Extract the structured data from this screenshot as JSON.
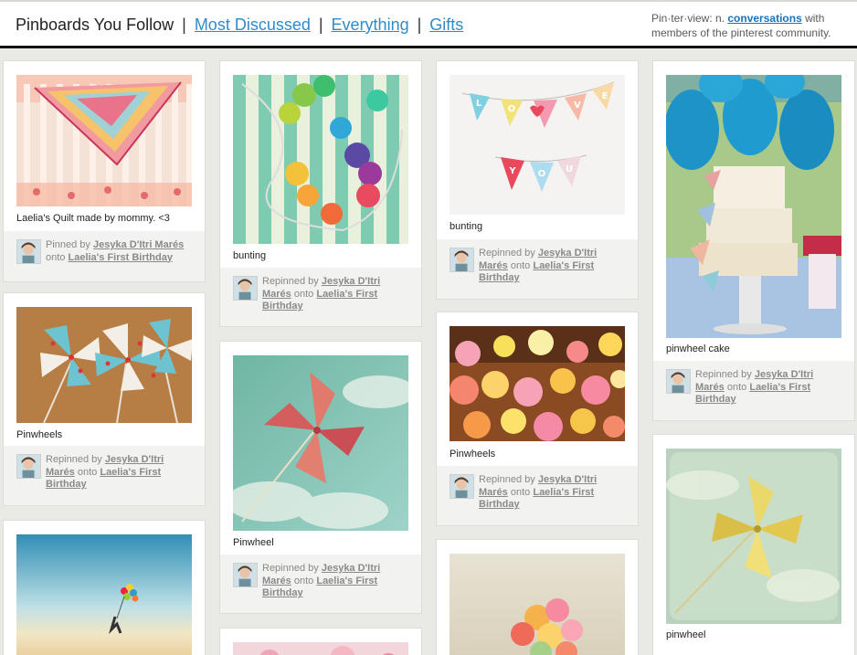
{
  "header": {
    "nav": {
      "current": "Pinboards You Follow",
      "links": [
        "Most Discussed",
        "Everything",
        "Gifts"
      ],
      "separator": "|"
    },
    "tagline": {
      "prefix": "Pin·ter·view: n.",
      "link": "conversations",
      "suffix": "with members of the pinterest community."
    }
  },
  "pins": [
    {
      "description": "Laelia's Quilt made by mommy. <3",
      "action": "Pinned by",
      "user": "Jesyka D'Itri Marés",
      "onto": "onto",
      "board": "Laelia's First Birthday"
    },
    {
      "description": "bunting",
      "action": "Repinned by",
      "user": "Jesyka D'Itri Marés",
      "onto": "onto",
      "board": "Laelia's First Birthday"
    },
    {
      "description": "bunting",
      "action": "Repinned by",
      "user": "Jesyka D'Itri Marés",
      "onto": "onto",
      "board": "Laelia's First Birthday"
    },
    {
      "description": "pinwheel cake",
      "action": "Repinned by",
      "user": "Jesyka D'Itri Marés",
      "onto": "onto",
      "board": "Laelia's First Birthday"
    },
    {
      "description": "Pinwheels",
      "action": "Repinned by",
      "user": "Jesyka D'Itri Marés",
      "onto": "onto",
      "board": "Laelia's First Birthday"
    },
    {
      "description": "Pinwheel",
      "action": "Repinned by",
      "user": "Jesyka D'Itri Marés",
      "onto": "onto",
      "board": "Laelia's First Birthday"
    },
    {
      "description": "Pinwheels",
      "action": "Repinned by",
      "user": "Jesyka D'Itri Marés",
      "onto": "onto",
      "board": "Laelia's First Birthday"
    },
    {
      "description": "pinwheel",
      "action": "",
      "user": "",
      "onto": "",
      "board": ""
    }
  ],
  "bunting_letters": [
    "L",
    "O",
    "V",
    "E",
    "Y",
    "O",
    "U"
  ],
  "colors": {
    "link_blue": "#2e8bc9",
    "background": "#e9e9e6",
    "attribution_bg": "#f2f2f1"
  }
}
